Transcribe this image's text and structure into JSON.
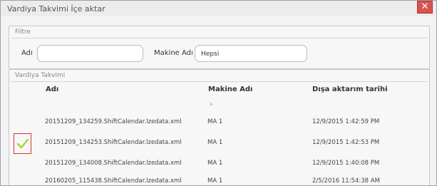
{
  "window": {
    "title": "Vardiya Takvimi İçe aktar",
    "close_label": "✕"
  },
  "filter": {
    "heading": "Filtre",
    "name_label": "Adı",
    "name_value": "",
    "machine_label": "Makine Adı",
    "machine_value": "Hepsi"
  },
  "calendar": {
    "heading": "Vardiya Takvimi",
    "columns": [
      "Adı",
      "Makine Adı",
      "Dışa aktarım tarihi"
    ],
    "sort_glyph": "▲",
    "rows": [
      {
        "name": "20151209_134259.ShiftCalendar.lzedata.xml",
        "machine": "MA 1",
        "date": "12/9/2015 1:42:59 PM",
        "selected": false
      },
      {
        "name": "20151209_134253.ShiftCalendar.lzedata.xml",
        "machine": "MA 1",
        "date": "12/9/2015 1:42:53 PM",
        "selected": true
      },
      {
        "name": "20151209_134008.ShiftCalendar.lzedata.xml",
        "machine": "MA 1",
        "date": "12/9/2015 1:40:08 PM",
        "selected": false
      },
      {
        "name": "20160205_115438.ShiftCalendar.lzedata.xml",
        "machine": "MA 1",
        "date": "2/5/2016 11:54:38 AM",
        "selected": false
      }
    ]
  },
  "colors": {
    "close_bg": "#d9534f",
    "check": "#a8d832",
    "highlight": "#e03030"
  },
  "icons": {
    "close": "close-icon",
    "selected": "checkmark-icon"
  }
}
